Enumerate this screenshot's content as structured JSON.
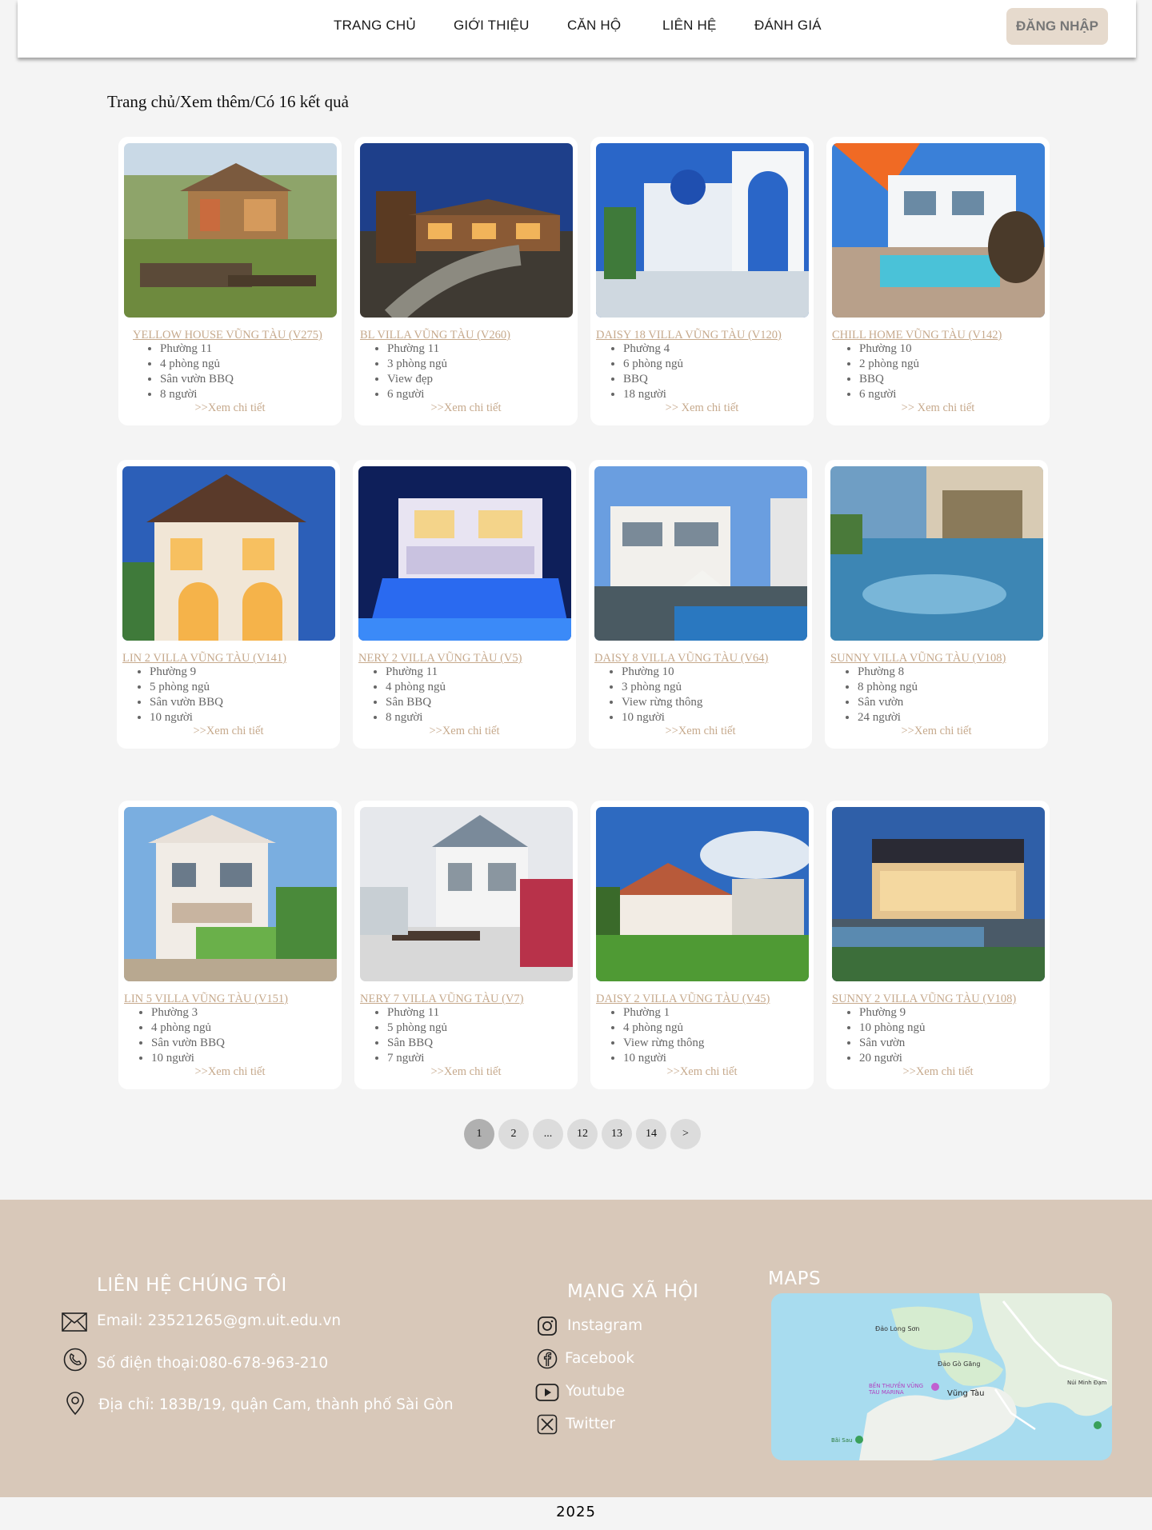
{
  "nav": {
    "items": [
      "TRANG CHỦ",
      "GIỚI THIỆU",
      "CĂN HỘ",
      "LIÊN HỆ",
      "ĐÁNH GIÁ"
    ],
    "login": "ĐĂNG NHẬP"
  },
  "breadcrumb": "Trang chủ/Xem thêm/Có 16 kết quả",
  "listings": [
    {
      "title": "YELLOW HOUSE VŨNG TÀU  (V275)",
      "features": [
        "Phường 11",
        "4 phòng ngủ",
        "Sân vườn BBQ",
        "8 người"
      ],
      "more": ">>Xem chi tiết"
    },
    {
      "title": "BL VILLA VŨNG TÀU (V260)",
      "features": [
        "Phường 11",
        "3 phòng ngủ",
        "View đẹp",
        "6 người"
      ],
      "more": ">>Xem chi tiết"
    },
    {
      "title": "DAISY 18 VILLA VŨNG TÀU (V120)",
      "features": [
        "Phường 4",
        "6 phòng ngủ",
        "BBQ",
        "18 người"
      ],
      "more": ">> Xem chi tiết"
    },
    {
      "title": "CHILL HOME VŨNG TÀU (V142)",
      "features": [
        "Phường 10",
        "2 phòng ngủ",
        "BBQ",
        "6 người"
      ],
      "more": ">> Xem chi tiết"
    },
    {
      "title": "LIN 2 VILLA VŨNG TÀU (V141)",
      "features": [
        "Phường 9",
        "5 phòng ngủ",
        "Sân vườn BBQ",
        "10 người"
      ],
      "more": ">>Xem chi tiết"
    },
    {
      "title": "NERY 2 VILLA VŨNG TÀU  (V5)",
      "features": [
        "Phường 11",
        "4 phòng ngủ",
        "Sân BBQ",
        "8 người"
      ],
      "more": ">>Xem chi tiết"
    },
    {
      "title": "DAISY 8 VILLA VŨNG TÀU  (V64)",
      "features": [
        "Phường 10",
        "3 phòng ngủ",
        "View rừng thông",
        "10 người"
      ],
      "more": ">>Xem chi tiết"
    },
    {
      "title": "SUNNY VILLA VŨNG TÀU (V108)",
      "features": [
        "Phường 8",
        "8 phòng ngủ",
        "Sân vườn",
        "24 người"
      ],
      "more": ">>Xem chi tiết"
    },
    {
      "title": "LIN 5 VILLA VŨNG TÀU (V151)",
      "features": [
        "Phường 3",
        "4 phòng ngủ",
        "Sân vườn BBQ",
        "10 người"
      ],
      "more": ">>Xem chi tiết"
    },
    {
      "title": "NERY 7 VILLA VŨNG TÀU  (V7)",
      "features": [
        "Phường 11",
        "5 phòng ngủ",
        "Sân BBQ",
        "7 người"
      ],
      "more": ">>Xem chi tiết"
    },
    {
      "title": "DAISY 2 VILLA VŨNG TÀU  (V45)",
      "features": [
        "Phường 1",
        "4 phòng ngủ",
        "View rừng thông",
        "10 người"
      ],
      "more": ">>Xem chi tiết"
    },
    {
      "title": "SUNNY 2 VILLA VŨNG TÀU (V108)",
      "features": [
        "Phường 9",
        "10 phòng ngủ",
        "Sân vườn",
        "20 người"
      ],
      "more": ">>Xem chi tiết"
    }
  ],
  "pagination": {
    "pages": [
      "1",
      "2",
      "...",
      "12",
      "13",
      "14",
      ">"
    ],
    "active": "1"
  },
  "footer": {
    "contact_heading": "LIÊN HỆ CHÚNG TÔI",
    "email": "Email: 23521265@gm.uit.edu.vn",
    "phone": "Số điện thoại:080-678-963-210",
    "address": "Địa chỉ: 183B/19, quận Cam, thành phố Sài Gòn",
    "social_heading": "MẠNG XÃ HỘI",
    "social": [
      "Instagram",
      "Facebook",
      "Youtube",
      "Twitter"
    ],
    "maps_heading": "MAPS",
    "map_labels": [
      "Đảo Long Sơn",
      "Đảo Gò Găng",
      "Vũng Tàu",
      "BẾN THUYỀN VŨNG TÀU MARINA",
      "Núi Minh Đạm",
      "Bãi Sau"
    ],
    "copyright": "2025"
  },
  "colors": {
    "accent": "#c6a98c",
    "footer_bg": "#d8c8b9",
    "login_bg": "#e6dacd"
  },
  "icons": [
    "mail-icon",
    "phone-icon",
    "location-pin-icon",
    "instagram-icon",
    "facebook-icon",
    "youtube-icon",
    "twitter-x-icon"
  ]
}
